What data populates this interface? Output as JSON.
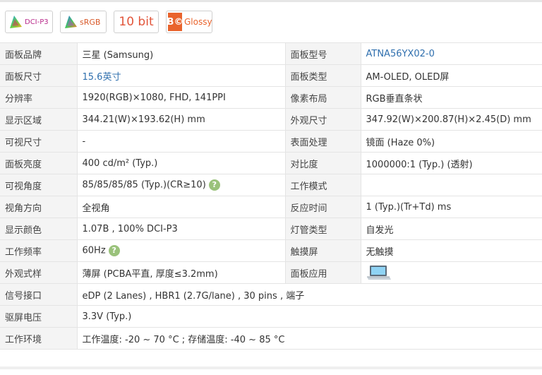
{
  "badges": {
    "dci": "DCI-P3",
    "srgb": "sRGB",
    "bit": "10 bit",
    "bc_letters": "B©",
    "glossy": "Glossy"
  },
  "help_glyph": "?",
  "rows": [
    {
      "k1": "面板品牌",
      "v1": "三星 (Samsung)",
      "k2": "面板型号",
      "v2": "ATNA56YX02-0"
    },
    {
      "k1": "面板尺寸",
      "v1": "15.6英寸",
      "k2": "面板类型",
      "v2": "AM-OLED, OLED屏"
    },
    {
      "k1": "分辨率",
      "v1": "1920(RGB)×1080, FHD, 141PPI",
      "k2": "像素布局",
      "v2": "RGB垂直条状"
    },
    {
      "k1": "显示区域",
      "v1": "344.21(W)×193.62(H) mm",
      "k2": "外观尺寸",
      "v2": "347.92(W)×200.87(H)×2.45(D) mm"
    },
    {
      "k1": "可视尺寸",
      "v1": "-",
      "k2": "表面处理",
      "v2": "镜面 (Haze 0%)"
    },
    {
      "k1": "面板亮度",
      "v1": "400 cd/m² (Typ.)",
      "k2": "对比度",
      "v2": "1000000:1 (Typ.) (透射)"
    },
    {
      "k1": "可视角度",
      "v1": "85/85/85/85 (Typ.)(CR≥10)",
      "k2": "工作模式",
      "v2": ""
    },
    {
      "k1": "视角方向",
      "v1": "全视角",
      "k2": "反应时间",
      "v2": "1 (Typ.)(Tr+Td) ms"
    },
    {
      "k1": "显示颜色",
      "v1": "1.07B , 100% DCI-P3",
      "k2": "灯管类型",
      "v2": "自发光"
    },
    {
      "k1": "工作频率",
      "v1": "60Hz",
      "k2": "触摸屏",
      "v2": "无触摸"
    },
    {
      "k1": "外观式样",
      "v1": "薄屏 (PCBA平直, 厚度≤3.2mm)",
      "k2": "面板应用",
      "v2": ""
    },
    {
      "k1": "信号接口",
      "v1": "eDP (2 Lanes) , HBR1 (2.7G/lane) , 30 pins , 端子"
    },
    {
      "k1": "驱屏电压",
      "v1": "3.3V (Typ.)"
    },
    {
      "k1": "工作环境",
      "v1": "工作温度: -20 ~ 70 °C ; 存储温度: -40 ~ 85 °C"
    }
  ]
}
